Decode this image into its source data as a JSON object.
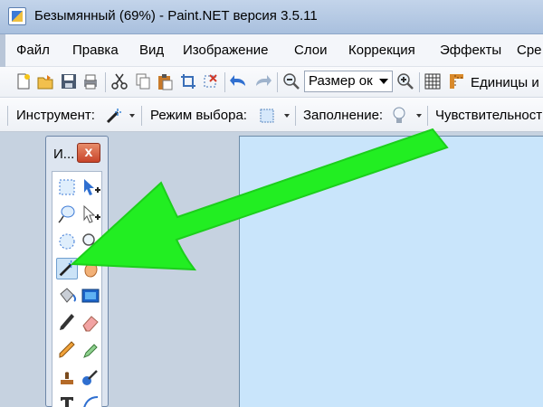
{
  "window": {
    "title": "Безымянный (69%) - Paint.NET версия 3.5.11"
  },
  "menu": {
    "items": [
      "Файл",
      "Правка",
      "Вид",
      "Изображение",
      "Слои",
      "Коррекция",
      "Эффекты",
      "Сре"
    ]
  },
  "toolbar": {
    "zoom_value": "Размер ок",
    "units_label": "Единицы и"
  },
  "options_bar": {
    "tool_label": "Инструмент:",
    "selection_mode_label": "Режим выбора:",
    "fill_label": "Заполнение:",
    "tolerance_label": "Чувствительност"
  },
  "tools_panel": {
    "title": "И...",
    "close_glyph": "x",
    "selected_tool": "magic-wand"
  },
  "colors": {
    "canvas": "#c9e5fb",
    "highlight_arrow": "#22ee22",
    "close_button": "#d6553a"
  }
}
